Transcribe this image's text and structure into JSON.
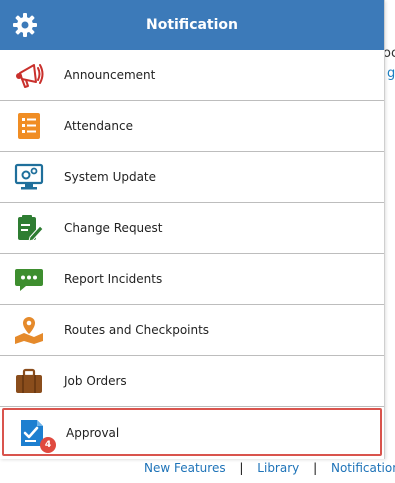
{
  "header": {
    "title": "Notification",
    "icon": "gear-icon"
  },
  "items": [
    {
      "label": "Announcement",
      "icon": "megaphone-icon"
    },
    {
      "label": "Attendance",
      "icon": "checklist-icon"
    },
    {
      "label": "System Update",
      "icon": "monitor-gear-icon"
    },
    {
      "label": "Change Request",
      "icon": "clipboard-edit-icon"
    },
    {
      "label": "Report Incidents",
      "icon": "chat-bubble-icon"
    },
    {
      "label": "Routes and Checkpoints",
      "icon": "map-pin-icon"
    },
    {
      "label": "Job Orders",
      "icon": "briefcase-icon"
    },
    {
      "label": "Approval",
      "icon": "approval-document-icon",
      "badge": "4",
      "selected": true
    }
  ],
  "footer": {
    "links": [
      "New Features",
      "Library",
      "Notification"
    ],
    "separator": "|"
  },
  "background": {
    "text1": "oc",
    "text2": "g"
  },
  "colors": {
    "header": "#3c7ab9",
    "badge": "#e04a3f",
    "selected_border": "#d9544d",
    "link": "#1e73b8"
  }
}
